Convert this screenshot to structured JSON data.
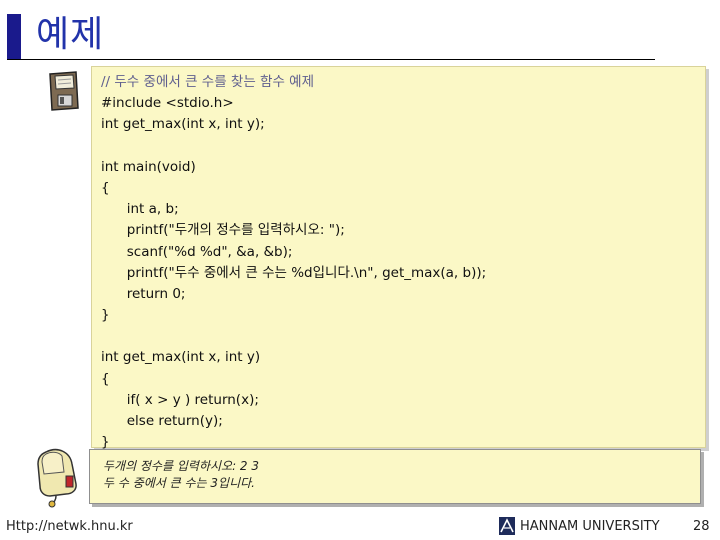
{
  "slide": {
    "title": "예제",
    "code_lines": [
      "// 두수 중에서 큰 수를 찾는 함수 예제",
      "#include <stdio.h>",
      "int get_max(int x, int y);",
      "",
      "int main(void)",
      "{",
      "      int a, b;",
      "      printf(\"두개의 정수를 입력하시오: \");",
      "      scanf(\"%d %d\", &a, &b);",
      "      printf(\"두수 중에서 큰 수는 %d입니다.\\n\", get_max(a, b));",
      "      return 0;",
      "}",
      "",
      "int get_max(int x, int y)",
      "{",
      "      if( x > y ) return(x);",
      "      else return(y);",
      "}"
    ],
    "output_lines": [
      "두개의 정수를 입력하시오: 2 3",
      "두 수 중에서 큰 수는 3입니다."
    ],
    "footer": {
      "url": "Http://netwk.hnu.kr",
      "university": "HANNAM UNIVERSITY",
      "page_number": "28"
    }
  }
}
